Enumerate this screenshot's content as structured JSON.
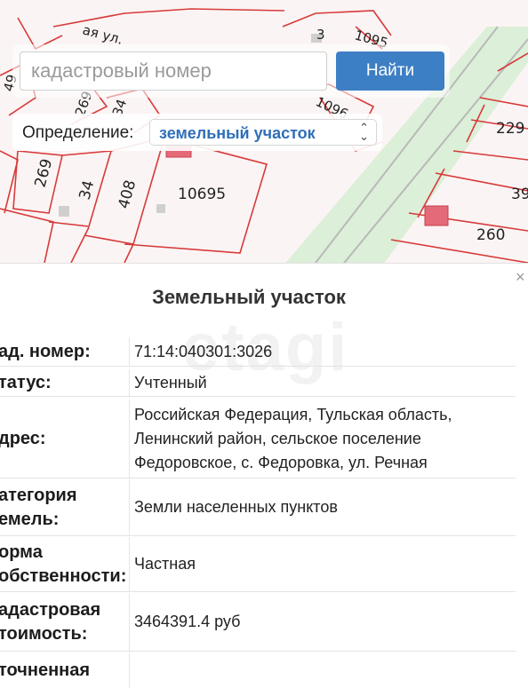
{
  "map": {
    "labels": [
      "ая ул.",
      "3",
      "1095",
      "49",
      "269",
      "34",
      "1096",
      "229",
      "269",
      "34",
      "408",
      "10695",
      "39",
      "260"
    ]
  },
  "search": {
    "placeholder": "кадастровый номер",
    "button": "Найти"
  },
  "definition": {
    "label": "Определение:",
    "value": "земельный участок"
  },
  "panel": {
    "title": "Земельный участок",
    "watermark": "etagi",
    "rows": [
      {
        "label": [
          "ад. номер:"
        ],
        "value": [
          "71:14:040301:3026"
        ]
      },
      {
        "label": [
          "татус:"
        ],
        "value": [
          "Учтенный"
        ]
      },
      {
        "label": [
          "дрес:"
        ],
        "value": [
          "Российская Федерация, Тульская область,",
          "Ленинский район, сельское поселение",
          "Федоровское, с. Федоровка, ул. Речная"
        ]
      },
      {
        "label": [
          "атегория",
          "емель:"
        ],
        "value": [
          "Земли населенных пунктов"
        ]
      },
      {
        "label": [
          "орма",
          "обственности:"
        ],
        "value": [
          "Частная"
        ]
      },
      {
        "label": [
          "адастровая",
          "тоимость:"
        ],
        "value": [
          "3464391.4 руб"
        ]
      },
      {
        "label": [
          "точненная"
        ],
        "value": [
          ""
        ]
      }
    ]
  }
}
